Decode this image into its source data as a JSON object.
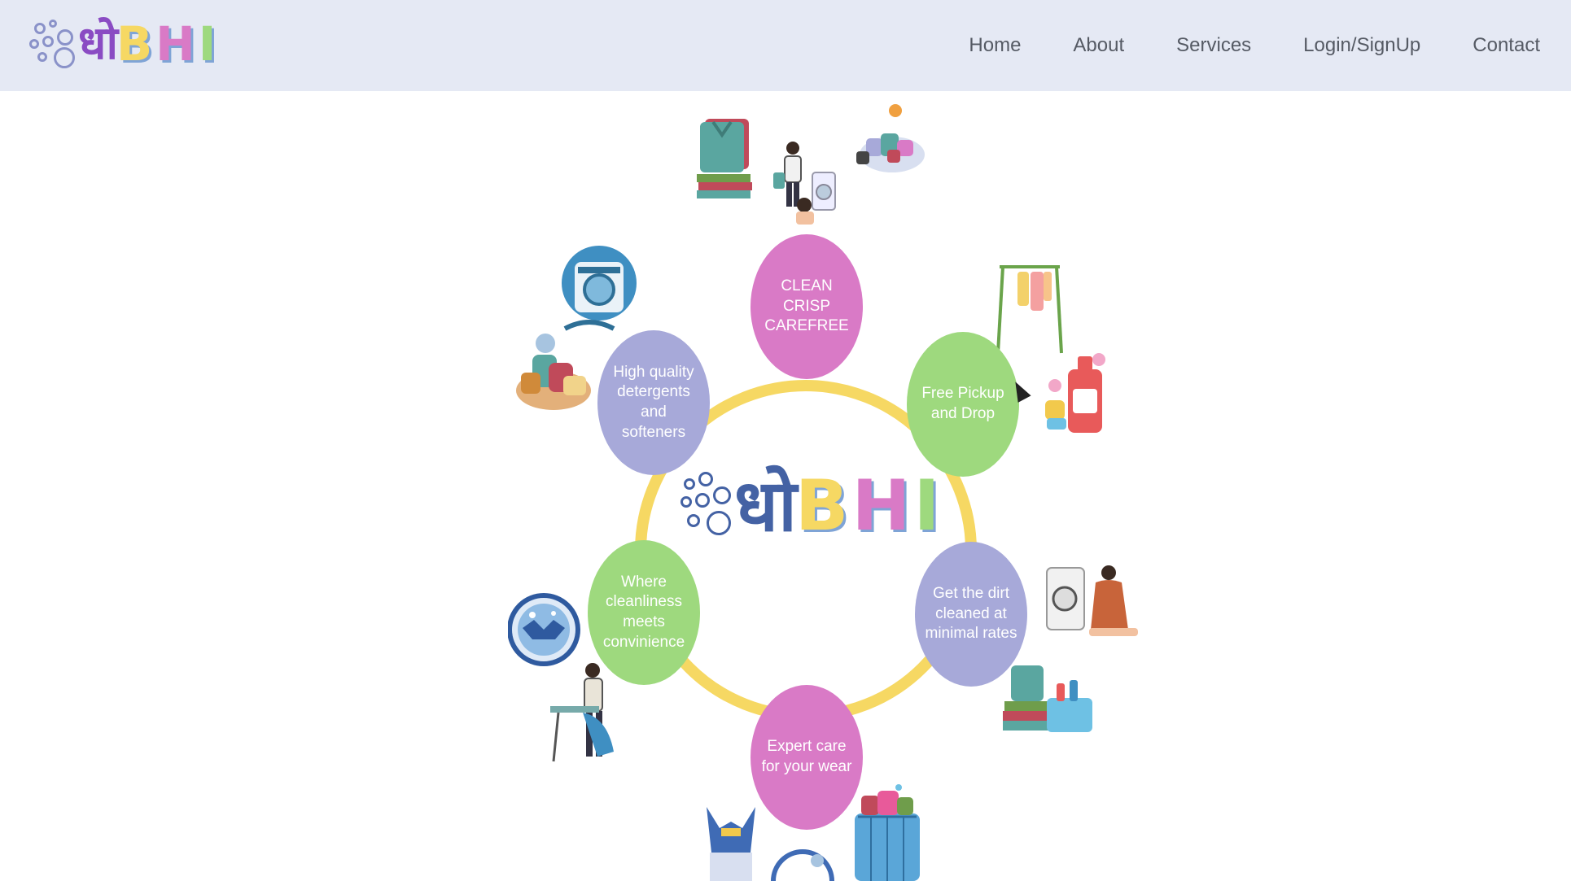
{
  "header": {
    "logo": {
      "script": "धो",
      "latin": "BHI"
    },
    "nav": [
      "Home",
      "About",
      "Services",
      "Login/SignUp",
      "Contact"
    ]
  },
  "center_logo": {
    "script": "धो",
    "latin": "BHI"
  },
  "nodes": [
    {
      "text": "CLEAN CRISP CAREFREE",
      "color": "#d97ac6"
    },
    {
      "text": "Free Pickup and Drop",
      "color": "#9ed97e"
    },
    {
      "text": "Get the dirt cleaned at minimal rates",
      "color": "#a7a9d9"
    },
    {
      "text": "Expert care for your wear",
      "color": "#d97ac6"
    },
    {
      "text": "Where cleanliness meets convinience",
      "color": "#9ed97e"
    },
    {
      "text": "High quality detergents and softeners",
      "color": "#a7a9d9"
    }
  ],
  "colors": {
    "ring": "#f6d863",
    "logo_dho": "#8a4bc3",
    "logo_b": "#f6d863",
    "logo_h": "#d97ac6",
    "logo_i": "#9ed97e"
  }
}
